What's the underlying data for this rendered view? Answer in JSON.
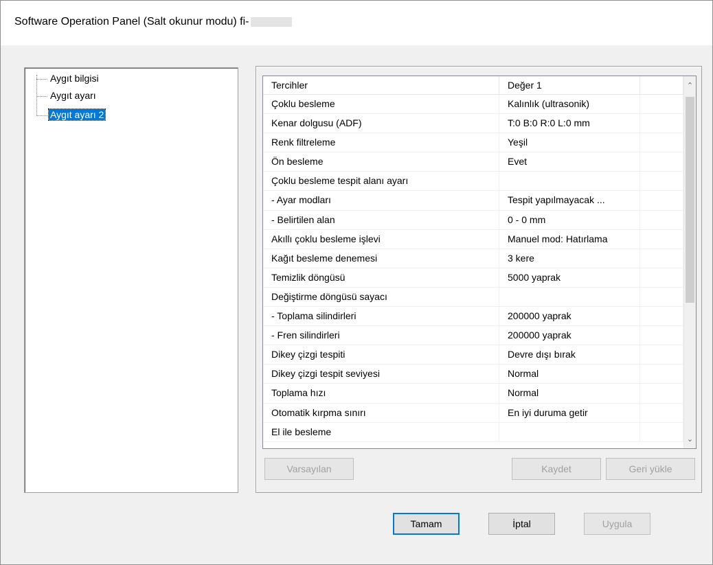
{
  "window": {
    "title": "Software Operation Panel (Salt okunur modu) fi-"
  },
  "tree": {
    "items": [
      {
        "label": "Aygıt bilgisi"
      },
      {
        "label": "Aygıt ayarı"
      },
      {
        "label": "Aygıt ayarı 2",
        "selected": true
      }
    ]
  },
  "list": {
    "headers": [
      "Tercihler",
      "Değer 1",
      ""
    ],
    "rows": [
      [
        "Çoklu besleme",
        "Kalınlık (ultrasonik)"
      ],
      [
        "Kenar dolgusu (ADF)",
        "T:0 B:0 R:0 L:0 mm"
      ],
      [
        "Renk filtreleme",
        "Yeşil"
      ],
      [
        "Ön besleme",
        "Evet"
      ],
      [
        "Çoklu besleme tespit alanı ayarı",
        ""
      ],
      [
        " - Ayar modları",
        "Tespit yapılmayacak ..."
      ],
      [
        " - Belirtilen alan",
        "0 - 0 mm"
      ],
      [
        "Akıllı çoklu besleme işlevi",
        "Manuel mod: Hatırlama"
      ],
      [
        "Kağıt besleme denemesi",
        "3 kere"
      ],
      [
        "Temizlik döngüsü",
        "5000 yaprak"
      ],
      [
        "Değiştirme döngüsü sayacı",
        ""
      ],
      [
        " - Toplama silindirleri",
        "200000 yaprak"
      ],
      [
        " - Fren silindirleri",
        "200000 yaprak"
      ],
      [
        "Dikey çizgi tespiti",
        "Devre dışı bırak"
      ],
      [
        "Dikey çizgi tespit seviyesi",
        "Normal"
      ],
      [
        "Toplama hızı",
        "Normal"
      ],
      [
        "Otomatik kırpma sınırı",
        "En iyi duruma getir"
      ],
      [
        "El ile besleme",
        ""
      ]
    ]
  },
  "buttons": {
    "defaults": "Varsayılan",
    "save": "Kaydet",
    "restore": "Geri yükle",
    "ok": "Tamam",
    "cancel": "İptal",
    "apply": "Uygula"
  },
  "scroll_icons": {
    "up": "chevron-up-icon",
    "down": "chevron-down-icon"
  }
}
